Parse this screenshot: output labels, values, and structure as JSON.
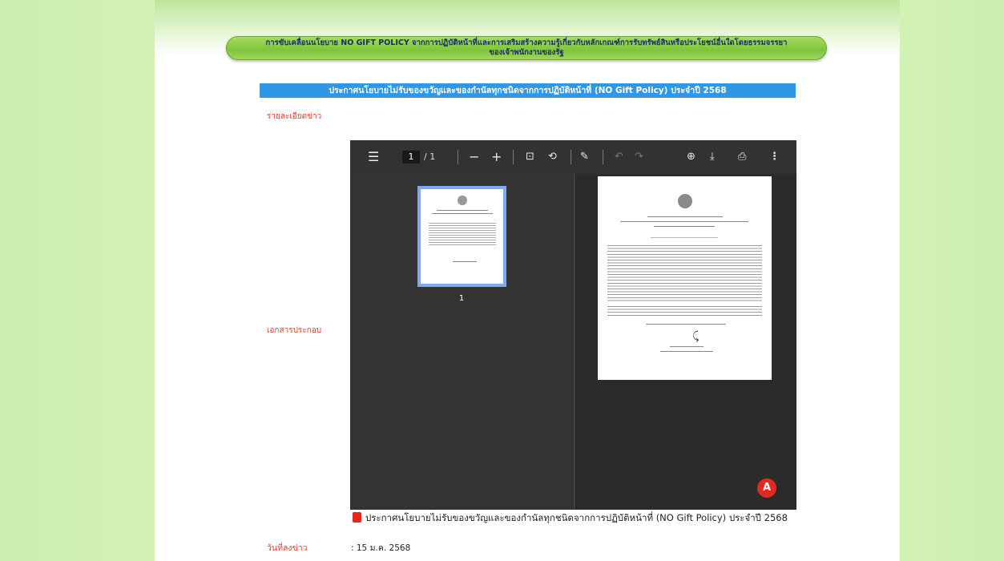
{
  "banner": {
    "line1": "การขับเคลื่อนนโยบาย NO GIFT POLICY จากการปฏิบัติหน้าที่และการเสริมสร้างความรู้เกี่ยวกับหลักเกณฑ์การรับทรัพย์สินหรือประโยชน์อื่นใดโดยธรรมจรรยา",
    "line2": "ของเจ้าพนักงานของรัฐ"
  },
  "announcement": {
    "title": "ประกาศนโยบายไม่รับของขวัญและของกำนัลทุกชนิดจากการปฏิบัติหน้าที่ (NO Gift Policy) ประจำปี 2568",
    "details_label": "รายละเอียดข่าว",
    "attachment_label": "เอกสารประกอบ",
    "download_text": "ประกาศนโยบายไม่รับของขวัญและของกำนัลทุกชนิดจากการปฏิบัติหน้าที่ (NO Gift Policy) ประจำปี 2568",
    "date_label": "วันที่ลงข่าว",
    "date_value": ": 15 ม.ค. 2568"
  },
  "viewer": {
    "current_page": "1",
    "total_pages": "/ 1",
    "thumbnail_number": "1",
    "icons": [
      "menu-icon",
      "zoom-out-icon",
      "zoom-in-icon",
      "fit-page-icon",
      "rotate-icon",
      "draw-icon",
      "undo-icon",
      "redo-icon",
      "save-icon",
      "download-icon",
      "print-icon",
      "more-icon",
      "adobe-pdf-icon"
    ]
  },
  "colors": {
    "accent_bar": "#2f97e6",
    "label_red": "#e8372a",
    "banner_green": "#7fc43d",
    "side_green": "#d2f2b4"
  }
}
